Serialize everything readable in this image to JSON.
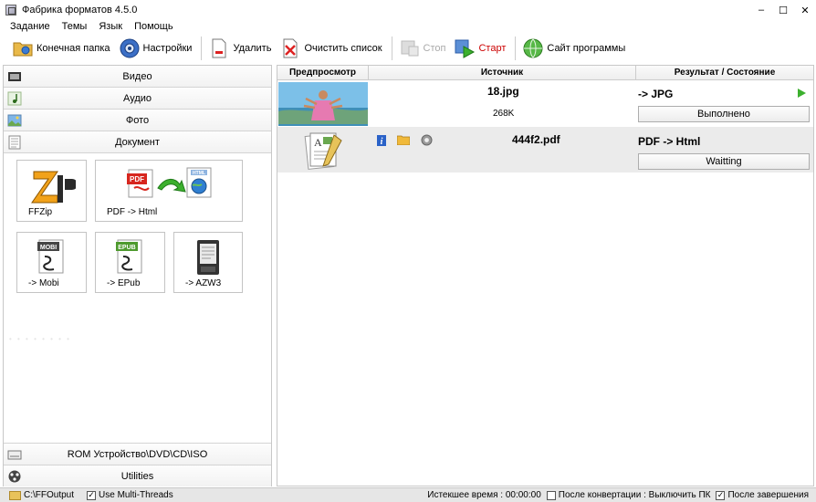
{
  "window": {
    "title": "Фабрика форматов 4.5.0",
    "minimize": "–",
    "maximize": "☐",
    "close": "✕"
  },
  "menu": [
    "Задание",
    "Темы",
    "Язык",
    "Помощь"
  ],
  "toolbar": {
    "output_folder": "Конечная папка",
    "settings": "Настройки",
    "delete": "Удалить",
    "clear_list": "Очистить список",
    "stop": "Стоп",
    "start": "Старт",
    "website": "Сайт программы"
  },
  "categories": {
    "video": "Видео",
    "audio": "Аудио",
    "photo": "Фото",
    "document": "Документ",
    "rom": "ROM Устройство\\DVD\\CD\\ISO",
    "utilities": "Utilities"
  },
  "tiles": {
    "ffzip": "FFZip",
    "pdf_html": "PDF -> Html",
    "mobi": "-> Mobi",
    "epub": "-> EPub",
    "azw3": "-> AZW3",
    "pdf_icon_text": "PDF",
    "html_icon_text": "HTML",
    "mobi_icon_text": "MOBI",
    "epub_icon_text": "EPUB"
  },
  "table": {
    "headers": [
      "Предпросмотр",
      "Источник",
      "Результат / Состояние"
    ],
    "rows": [
      {
        "name": "18.jpg",
        "size": "268K",
        "result": "-> JPG",
        "status": "Выполнено"
      },
      {
        "name": "444f2.pdf",
        "size": "",
        "result": "PDF -> Html",
        "status": "Waitting"
      }
    ]
  },
  "statusbar": {
    "output_path": "C:\\FFOutput",
    "multithread": "Use Multi-Threads",
    "elapsed": "Истекшее время : 00:00:00",
    "after_convert": "После конвертации : Выключить ПК",
    "after_finish": "После завершения"
  },
  "colors": {
    "start_red": "#cc0000",
    "play_green": "#3cb02e",
    "selected_row": "#ebebeb"
  }
}
